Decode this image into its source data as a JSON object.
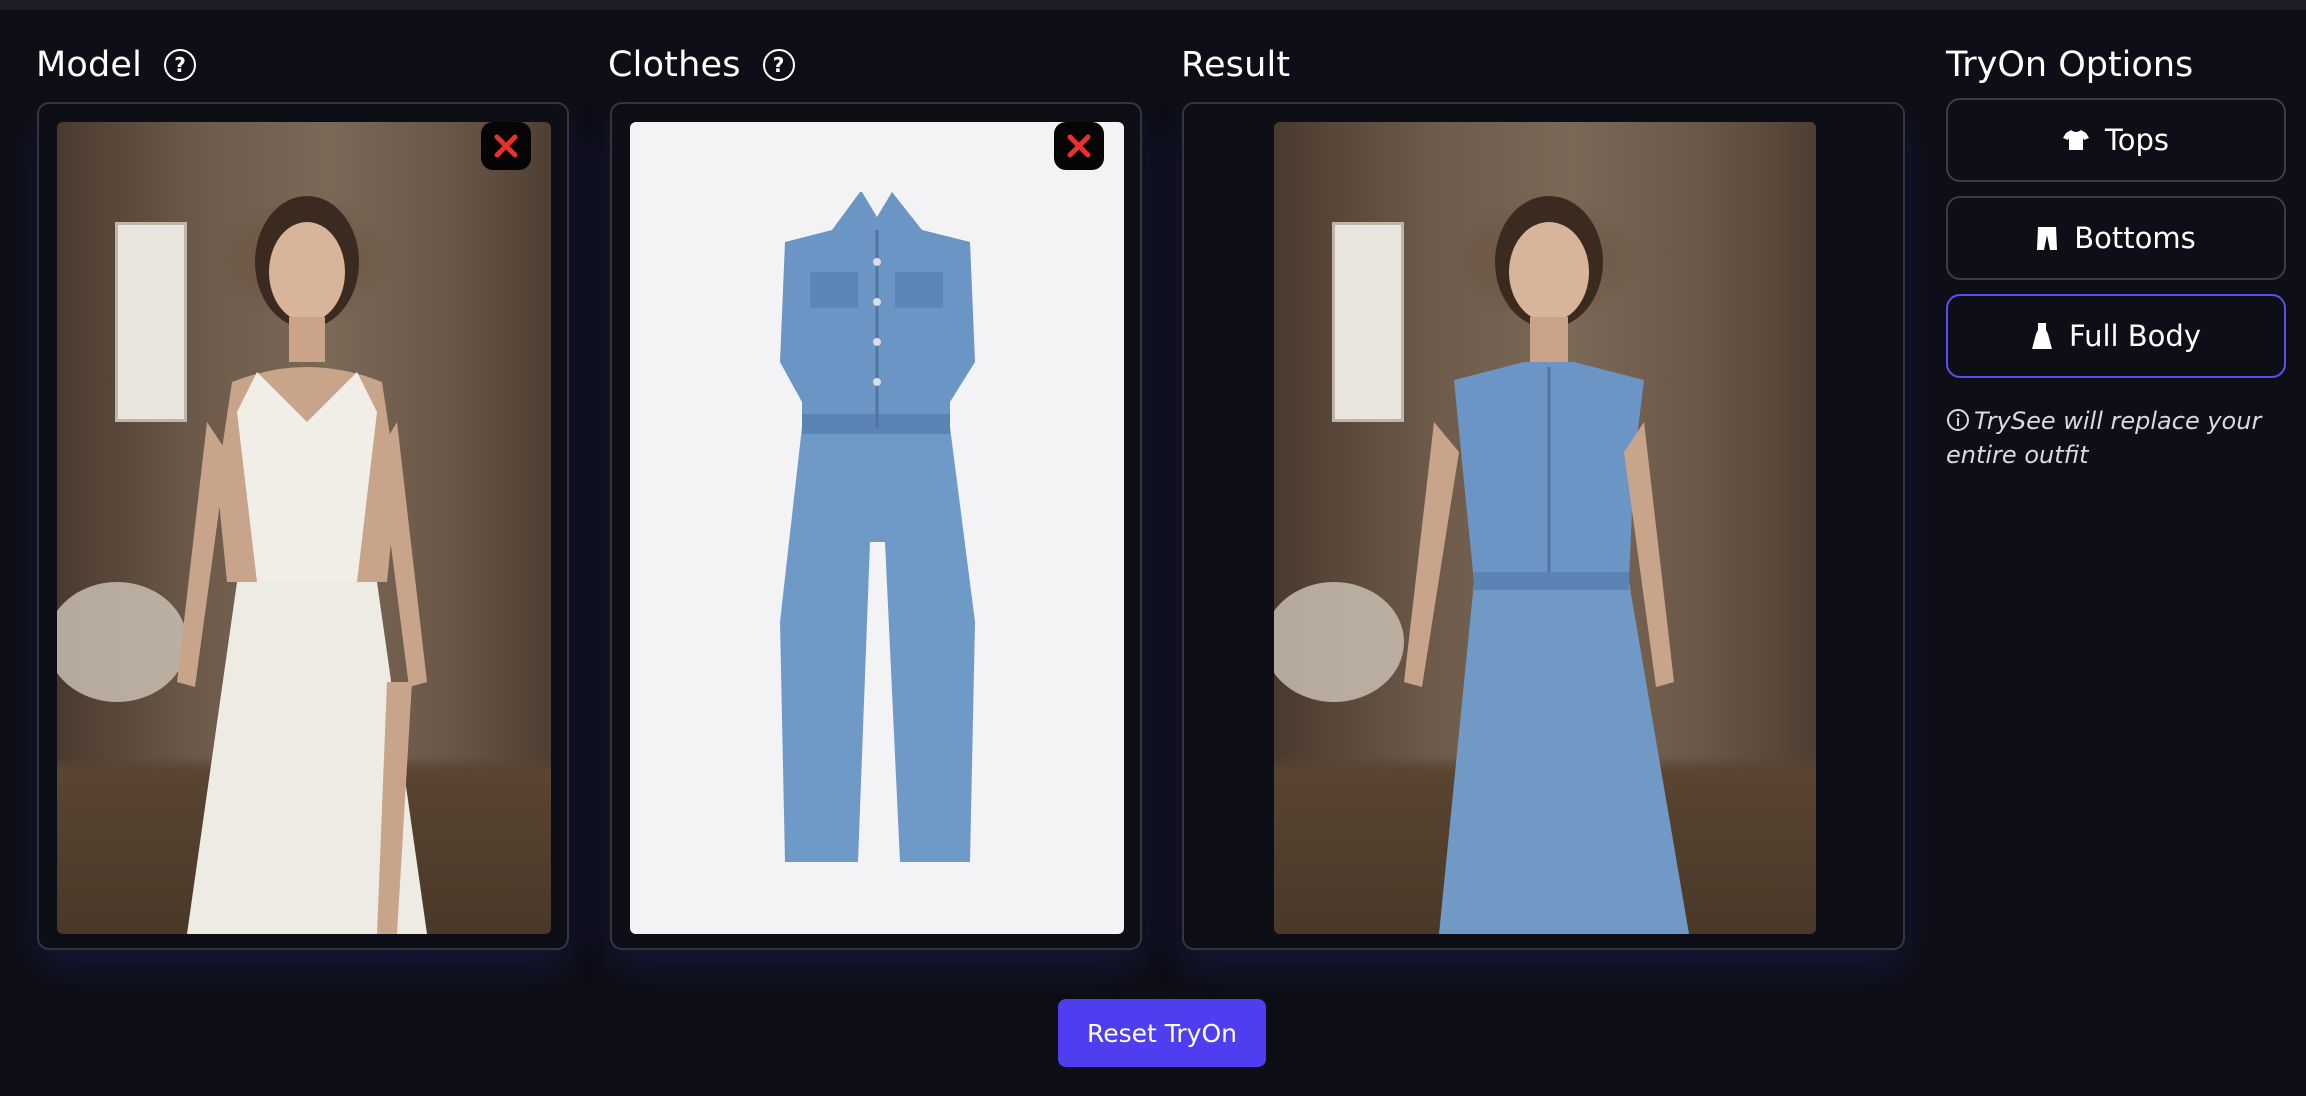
{
  "columns": {
    "model": {
      "title": "Model"
    },
    "clothes": {
      "title": "Clothes"
    },
    "result": {
      "title": "Result"
    }
  },
  "icons": {
    "help": "question-circle-icon",
    "remove": "close-x-icon",
    "tops": "tshirt-icon",
    "bottoms": "pants-icon",
    "full_body": "dress-icon",
    "info": "info-circle-icon"
  },
  "tryon_options": {
    "title": "TryOn Options",
    "buttons": [
      {
        "label": "Tops",
        "selected": false
      },
      {
        "label": "Bottoms",
        "selected": false
      },
      {
        "label": "Full Body",
        "selected": true
      }
    ],
    "note": "TrySee will replace your entire outfit"
  },
  "reset_label": "Reset TryOn",
  "colors": {
    "background": "#0d0e16",
    "accent": "#4f3ef0",
    "selected_border": "#5d4ef0",
    "remove_x": "#e5332b",
    "denim": "#6a95c4"
  }
}
